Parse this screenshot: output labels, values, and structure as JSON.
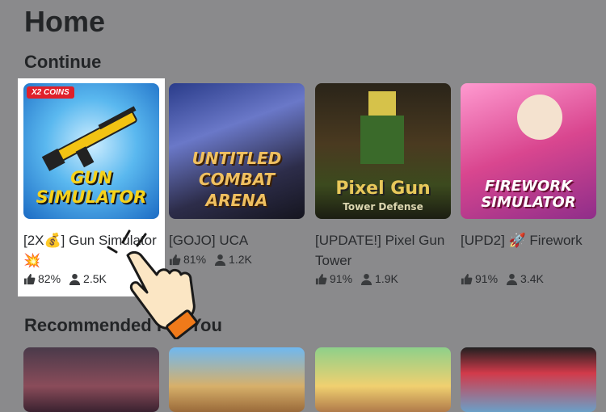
{
  "page": {
    "title": "Home"
  },
  "sections": {
    "continue": "Continue",
    "recommended": "Recommended For You"
  },
  "continue_games": [
    {
      "name": "[2X💰] Gun Simulator 💥",
      "thumb_title": "GUN SIMULATOR",
      "badge": "X2 COINS",
      "rating": "82%",
      "players": "2.5K"
    },
    {
      "name": "[GOJO] UCA",
      "thumb_title": "UNTITLED COMBAT ARENA",
      "rating": "81%",
      "players": "1.2K"
    },
    {
      "name": "[UPDATE!] Pixel Gun Tower",
      "thumb_title": "Pixel Gun",
      "thumb_subtitle": "Tower Defense",
      "rating": "91%",
      "players": "1.9K"
    },
    {
      "name": "[UPD2] 🚀 Firework",
      "thumb_title": "FIREWORK SIMULATOR",
      "rating": "91%",
      "players": "3.4K"
    }
  ],
  "icons": {
    "rating": "thumbs-up-icon",
    "players": "person-icon",
    "pointer": "pointing-hand-icon"
  }
}
